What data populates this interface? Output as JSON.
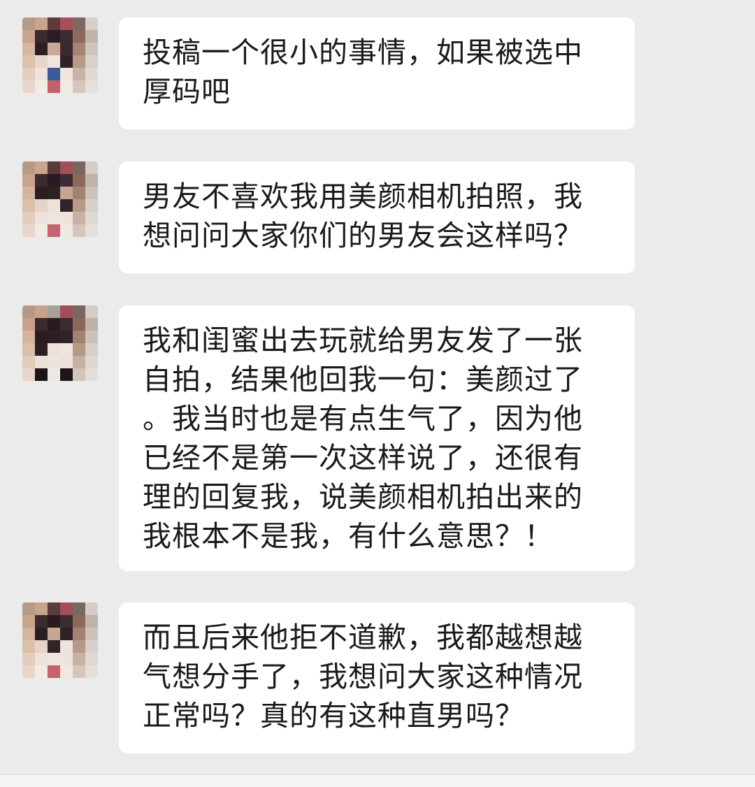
{
  "messages": [
    {
      "text": "投稿一个很小的事情，如果被选中\n厚码吧"
    },
    {
      "text": "男友不喜欢我用美颜相机拍照，我\n想问问大家你们的男友会这样吗？"
    },
    {
      "text": "我和闺蜜出去玩就给男友发了一张\n自拍，结果他回我一句：美颜过了\n。我当时也是有点生气了，因为他\n已经不是第一次这样说了，还很有\n理的回复我，说美颜相机拍出来的\n我根本不是我，有什么意思？！"
    },
    {
      "text": "而且后来他拒不道歉，我都越想越\n气想分手了，我想问大家这种情况\n正常吗？真的有这种直男吗？"
    }
  ],
  "colors": {
    "background": "#ebebeb",
    "bubble": "#ffffff",
    "text": "#1a1a1a"
  }
}
